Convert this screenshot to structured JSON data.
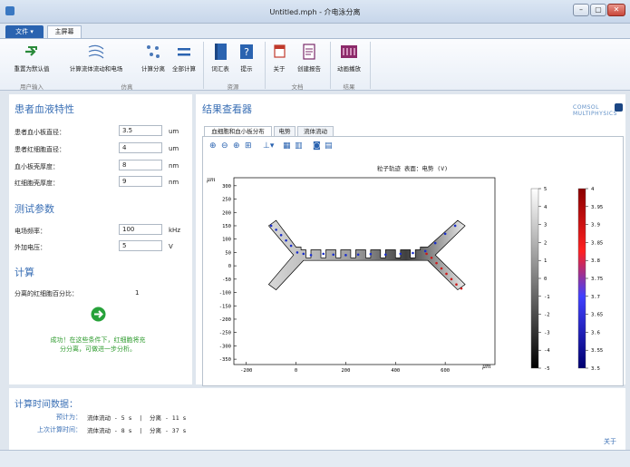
{
  "window": {
    "title": "Untitled.mph - 介电泳分离",
    "min": "–",
    "max": "▢",
    "close": "✕"
  },
  "ribbon_tabs": {
    "file": "文件 ▾",
    "home": "主屏幕"
  },
  "ribbon": {
    "buttons": [
      {
        "label": "重置为默认值",
        "icon": "reset-icon"
      },
      {
        "label": "计算流体流动和电场",
        "icon": "flow-icon"
      },
      {
        "label": "计算分离",
        "icon": "separation-icon"
      },
      {
        "label": "全部计算",
        "icon": "compute-all-icon"
      },
      {
        "label": "词汇表",
        "icon": "book-icon"
      },
      {
        "label": "提示",
        "icon": "help-icon"
      },
      {
        "label": "关于",
        "icon": "about-icon"
      },
      {
        "label": "创建报告",
        "icon": "report-icon"
      },
      {
        "label": "动画播放",
        "icon": "animation-icon"
      }
    ],
    "groups": {
      "user_input": "用户输入",
      "simulation": "仿真",
      "resources": "资源",
      "documents": "文档",
      "results": "结果"
    }
  },
  "left": {
    "patient_title": "患者血液特性",
    "params": [
      {
        "label": "患者血小板直径：",
        "value": "3.5",
        "unit": "um"
      },
      {
        "label": "患者红细胞直径：",
        "value": "4",
        "unit": "um"
      },
      {
        "label": "血小板壳厚度：",
        "value": "8",
        "unit": "nm"
      },
      {
        "label": "红细胞壳厚度：",
        "value": "9",
        "unit": "nm"
      }
    ],
    "test_title": "测试参数",
    "test_params": [
      {
        "label": "电场频率：",
        "value": "100",
        "unit": "kHz"
      },
      {
        "label": "外加电压：",
        "value": "5",
        "unit": "V"
      }
    ],
    "compute_title": "计算",
    "rbc_percent_label": "分离的红细胞百分比：",
    "rbc_percent_value": "1",
    "success_line1": "成功！在这些条件下，红细胞将充",
    "success_line2": "分分离，可做进一步分析。"
  },
  "right": {
    "title": "结果查看器",
    "logo": "COMSOL MULTIPHYSICS",
    "tabs": [
      "血细胞和血小板分布",
      "电势",
      "流体流动"
    ],
    "plot_title": "粒子轨迹   表面：电势 (V)"
  },
  "chart_data": {
    "type": "heatmap",
    "title": "粒子轨迹   表面：电势 (V)",
    "xlabel": "μm",
    "ylabel": "μm",
    "xlim": [
      -250,
      800
    ],
    "ylim": [
      -370,
      330
    ],
    "x_ticks": [
      -200,
      0,
      200,
      400,
      600
    ],
    "y_ticks": [
      300,
      250,
      200,
      150,
      100,
      50,
      0,
      -50,
      -100,
      -150,
      -200,
      -250,
      -300,
      -350
    ],
    "colorbars": [
      {
        "name": "电势 (V)",
        "colors": [
          "#000000",
          "#ffffff"
        ],
        "ticks": [
          5,
          4,
          3,
          2,
          1,
          0,
          -1,
          -2,
          -3,
          -4,
          -5
        ]
      },
      {
        "name": "粒子",
        "colors": [
          "#000080",
          "#0000ff",
          "#ff0000",
          "#800000"
        ],
        "ticks": [
          4,
          3.95,
          3.9,
          3.85,
          3.8,
          3.75,
          3.7,
          3.65,
          3.6,
          3.55,
          3.5
        ]
      }
    ]
  },
  "bottom": {
    "title": "计算时间数据：",
    "est_label": "预计为：",
    "est_value": "流体流动 - 5 s  |  分离 - 11 s",
    "last_label": "上次计算时间：",
    "last_value": "流体流动 - 8 s  |  分离 - 37 s",
    "about_link": "关于"
  }
}
